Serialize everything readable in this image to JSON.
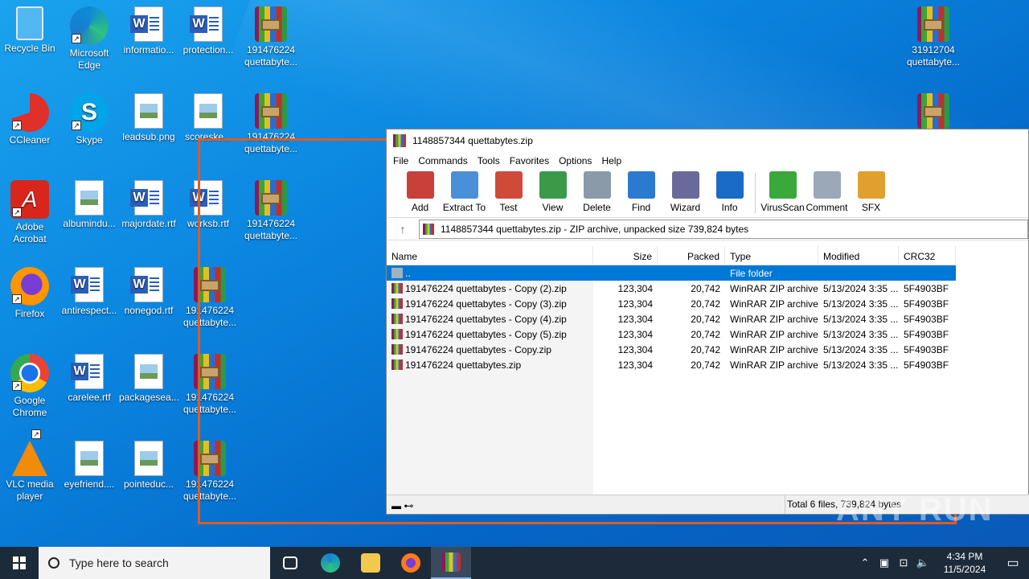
{
  "desktop": {
    "icons": [
      {
        "label": "Recycle Bin",
        "kind": "bin-icon"
      },
      {
        "label": "Microsoft Edge",
        "kind": "edge-icon"
      },
      {
        "label": "informatio...",
        "kind": "word-icon"
      },
      {
        "label": "protection...",
        "kind": "word-icon"
      },
      {
        "label": "191476224 quettabyte...",
        "kind": "winrar-icon"
      },
      {
        "label": "31912704 quettabyte...",
        "kind": "winrar-icon"
      },
      {
        "label": "CCleaner",
        "kind": "ccleaner-icon"
      },
      {
        "label": "Skype",
        "kind": "skype-icon"
      },
      {
        "label": "leadsub.png",
        "kind": "image-file-icon"
      },
      {
        "label": "scoreske...",
        "kind": "image-file-icon"
      },
      {
        "label": "191476224 quettabyte...",
        "kind": "winrar-icon"
      },
      {
        "label": "",
        "kind": "winrar-icon"
      },
      {
        "label": "Adobe Acrobat",
        "kind": "acrobat-icon"
      },
      {
        "label": "albumindu...",
        "kind": "image-file-icon"
      },
      {
        "label": "majordate.rtf",
        "kind": "word-icon"
      },
      {
        "label": "worksb.rtf",
        "kind": "word-icon"
      },
      {
        "label": "191476224 quettabyte...",
        "kind": "winrar-icon"
      },
      {
        "label": "Firefox",
        "kind": "firefox-icon"
      },
      {
        "label": "antirespect...",
        "kind": "word-icon"
      },
      {
        "label": "nonegod.rtf",
        "kind": "word-icon"
      },
      {
        "label": "191476224 quettabyte...",
        "kind": "winrar-icon"
      },
      {
        "label": "Google Chrome",
        "kind": "chrome-icon"
      },
      {
        "label": "carelee.rtf",
        "kind": "word-icon"
      },
      {
        "label": "packagesea...",
        "kind": "image-file-icon"
      },
      {
        "label": "191476224 quettabyte...",
        "kind": "winrar-icon"
      },
      {
        "label": "VLC media player",
        "kind": "vlc-icon"
      },
      {
        "label": "eyefriend....",
        "kind": "image-file-icon"
      },
      {
        "label": "pointeduc...",
        "kind": "image-file-icon"
      },
      {
        "label": "191476224 quettabyte...",
        "kind": "winrar-icon"
      }
    ]
  },
  "window": {
    "title": "1148857344 quettabytes.zip",
    "menu": [
      "File",
      "Commands",
      "Tools",
      "Favorites",
      "Options",
      "Help"
    ],
    "toolbar": [
      "Add",
      "Extract To",
      "Test",
      "View",
      "Delete",
      "Find",
      "Wizard",
      "Info",
      "VirusScan",
      "Comment",
      "SFX"
    ],
    "address": "1148857344 quettabytes.zip - ZIP archive, unpacked size 739,824 bytes",
    "columns": {
      "name": "Name",
      "size": "Size",
      "packed": "Packed",
      "type": "Type",
      "modified": "Modified",
      "crc": "CRC32"
    },
    "parent_row": {
      "name": "..",
      "type": "File folder"
    },
    "rows": [
      {
        "name": "191476224 quettabytes - Copy (2).zip",
        "size": "123,304",
        "packed": "20,742",
        "type": "WinRAR ZIP archive",
        "modified": "5/13/2024 3:35 ...",
        "crc": "5F4903BF"
      },
      {
        "name": "191476224 quettabytes - Copy (3).zip",
        "size": "123,304",
        "packed": "20,742",
        "type": "WinRAR ZIP archive",
        "modified": "5/13/2024 3:35 ...",
        "crc": "5F4903BF"
      },
      {
        "name": "191476224 quettabytes - Copy (4).zip",
        "size": "123,304",
        "packed": "20,742",
        "type": "WinRAR ZIP archive",
        "modified": "5/13/2024 3:35 ...",
        "crc": "5F4903BF"
      },
      {
        "name": "191476224 quettabytes - Copy (5).zip",
        "size": "123,304",
        "packed": "20,742",
        "type": "WinRAR ZIP archive",
        "modified": "5/13/2024 3:35 ...",
        "crc": "5F4903BF"
      },
      {
        "name": "191476224 quettabytes - Copy.zip",
        "size": "123,304",
        "packed": "20,742",
        "type": "WinRAR ZIP archive",
        "modified": "5/13/2024 3:35 ...",
        "crc": "5F4903BF"
      },
      {
        "name": "191476224 quettabytes.zip",
        "size": "123,304",
        "packed": "20,742",
        "type": "WinRAR ZIP archive",
        "modified": "5/13/2024 3:35 ...",
        "crc": "5F4903BF"
      }
    ],
    "status": "Total 6 files, 739,824 bytes"
  },
  "watermark": "ANY RUN",
  "taskbar": {
    "search_placeholder": "Type here to search",
    "time": "4:34 PM",
    "date": "11/5/2024"
  },
  "colors": {
    "selection": "#0078d7",
    "highlight_box": "#e35a1f",
    "taskbar": "#1c2a3a"
  }
}
